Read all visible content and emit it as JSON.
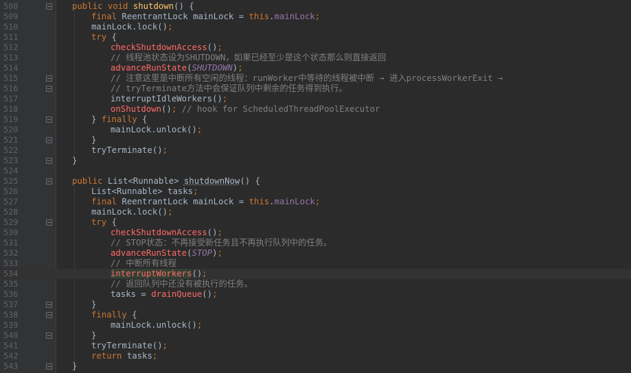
{
  "editor": {
    "lines": [
      {
        "n": "508",
        "indent": 0,
        "fold": true,
        "tokens": [
          [
            "kw",
            "public void "
          ],
          [
            "fn",
            "shutdown"
          ],
          [
            "txt",
            "() {"
          ]
        ]
      },
      {
        "n": "509",
        "indent": 1,
        "tokens": [
          [
            "kw",
            "final "
          ],
          [
            "txt",
            "ReentrantLock mainLock = "
          ],
          [
            "kw",
            "this"
          ],
          [
            "txt",
            "."
          ],
          [
            "fd",
            "mainLock"
          ],
          [
            "kw",
            ";"
          ]
        ]
      },
      {
        "n": "510",
        "indent": 1,
        "tokens": [
          [
            "txt",
            "mainLock.lock()"
          ],
          [
            "kw",
            ";"
          ]
        ]
      },
      {
        "n": "511",
        "indent": 1,
        "tokens": [
          [
            "kw",
            "try "
          ],
          [
            "txt",
            "{"
          ]
        ]
      },
      {
        "n": "512",
        "indent": 2,
        "tokens": [
          [
            "call",
            "checkShutdownAccess"
          ],
          [
            "txt",
            "()"
          ],
          [
            "kw",
            ";"
          ]
        ]
      },
      {
        "n": "513",
        "indent": 2,
        "tokens": [
          [
            "cm",
            "// 线程池状态设为SHUTDOWN，如果已经至少是这个状态那么则直接返回"
          ]
        ]
      },
      {
        "n": "514",
        "indent": 2,
        "tokens": [
          [
            "call",
            "advanceRunState"
          ],
          [
            "txt",
            "("
          ],
          [
            "it",
            "SHUTDOWN"
          ],
          [
            "txt",
            ")"
          ],
          [
            "kw",
            ";"
          ]
        ]
      },
      {
        "n": "515",
        "indent": 2,
        "fold": true,
        "tokens": [
          [
            "cm",
            "// 注意这里是中断所有空闲的线程：runWorker中等待的线程被中断 → 进入processWorkerExit →"
          ]
        ]
      },
      {
        "n": "516",
        "indent": 2,
        "fold": true,
        "tokens": [
          [
            "cm",
            "// tryTerminate方法中会保证队列中剩余的任务得到执行。"
          ]
        ]
      },
      {
        "n": "517",
        "indent": 2,
        "tokens": [
          [
            "txt",
            "interruptIdleWorkers()"
          ],
          [
            "kw",
            ";"
          ]
        ]
      },
      {
        "n": "518",
        "indent": 2,
        "tokens": [
          [
            "call",
            "onShutdown"
          ],
          [
            "txt",
            "()"
          ],
          [
            "kw",
            "; "
          ],
          [
            "cm",
            "// hook for ScheduledThreadPoolExecutor"
          ]
        ]
      },
      {
        "n": "519",
        "indent": 1,
        "fold": true,
        "tokens": [
          [
            "txt",
            "} "
          ],
          [
            "kw",
            "finally "
          ],
          [
            "txt",
            "{"
          ]
        ]
      },
      {
        "n": "520",
        "indent": 2,
        "tokens": [
          [
            "txt",
            "mainLock.unlock()"
          ],
          [
            "kw",
            ";"
          ]
        ]
      },
      {
        "n": "521",
        "indent": 1,
        "fold": true,
        "tokens": [
          [
            "txt",
            "}"
          ]
        ]
      },
      {
        "n": "522",
        "indent": 1,
        "tokens": [
          [
            "txt",
            "tryTerminate()"
          ],
          [
            "kw",
            ";"
          ]
        ]
      },
      {
        "n": "523",
        "indent": 0,
        "fold": true,
        "tokens": [
          [
            "txt",
            "}"
          ]
        ]
      },
      {
        "n": "524",
        "indent": 0,
        "tokens": []
      },
      {
        "n": "525",
        "indent": 0,
        "fold": true,
        "tokens": [
          [
            "kw",
            "public "
          ],
          [
            "txt",
            "List<Runnable> "
          ],
          [
            "dep",
            "shutdownNow"
          ],
          [
            "txt",
            "() {"
          ]
        ]
      },
      {
        "n": "526",
        "indent": 1,
        "tokens": [
          [
            "txt",
            "List<Runnable> tasks"
          ],
          [
            "kw",
            ";"
          ]
        ]
      },
      {
        "n": "527",
        "indent": 1,
        "tokens": [
          [
            "kw",
            "final "
          ],
          [
            "txt",
            "ReentrantLock mainLock = "
          ],
          [
            "kw",
            "this"
          ],
          [
            "txt",
            "."
          ],
          [
            "fd",
            "mainLock"
          ],
          [
            "kw",
            ";"
          ]
        ]
      },
      {
        "n": "528",
        "indent": 1,
        "tokens": [
          [
            "txt",
            "mainLock.lock()"
          ],
          [
            "kw",
            ";"
          ]
        ]
      },
      {
        "n": "529",
        "indent": 1,
        "fold": true,
        "tokens": [
          [
            "kw",
            "try "
          ],
          [
            "txt",
            "{"
          ]
        ]
      },
      {
        "n": "530",
        "indent": 2,
        "tokens": [
          [
            "call",
            "checkShutdownAccess"
          ],
          [
            "txt",
            "()"
          ],
          [
            "kw",
            ";"
          ]
        ]
      },
      {
        "n": "531",
        "indent": 2,
        "tokens": [
          [
            "cm",
            "// STOP状态：不再接受新任务且不再执行队列中的任务。"
          ]
        ]
      },
      {
        "n": "532",
        "indent": 2,
        "tokens": [
          [
            "call",
            "advanceRunState"
          ],
          [
            "txt",
            "("
          ],
          [
            "it",
            "STOP"
          ],
          [
            "txt",
            ")"
          ],
          [
            "kw",
            ";"
          ]
        ]
      },
      {
        "n": "533",
        "indent": 2,
        "tokens": [
          [
            "cm",
            "// 中断所有线程"
          ]
        ]
      },
      {
        "n": "534",
        "indent": 2,
        "current": true,
        "tokens": [
          [
            "call iw",
            "interruptWorkers"
          ],
          [
            "txt",
            "()"
          ],
          [
            "kw",
            ";"
          ]
        ]
      },
      {
        "n": "535",
        "indent": 2,
        "tokens": [
          [
            "cm",
            "// 返回队列中还没有被执行的任务。"
          ]
        ]
      },
      {
        "n": "536",
        "indent": 2,
        "tokens": [
          [
            "txt",
            "tasks = "
          ],
          [
            "call",
            "drainQueue"
          ],
          [
            "txt",
            "()"
          ],
          [
            "kw",
            ";"
          ]
        ]
      },
      {
        "n": "537",
        "indent": 1,
        "fold": true,
        "tokens": [
          [
            "txt",
            "}"
          ]
        ]
      },
      {
        "n": "538",
        "indent": 1,
        "fold": true,
        "tokens": [
          [
            "kw",
            "finally "
          ],
          [
            "txt",
            "{"
          ]
        ]
      },
      {
        "n": "539",
        "indent": 2,
        "tokens": [
          [
            "txt",
            "mainLock.unlock()"
          ],
          [
            "kw",
            ";"
          ]
        ]
      },
      {
        "n": "540",
        "indent": 1,
        "fold": true,
        "tokens": [
          [
            "txt",
            "}"
          ]
        ]
      },
      {
        "n": "541",
        "indent": 1,
        "tokens": [
          [
            "txt",
            "tryTerminate()"
          ],
          [
            "kw",
            ";"
          ]
        ]
      },
      {
        "n": "542",
        "indent": 1,
        "tokens": [
          [
            "kw",
            "return "
          ],
          [
            "txt",
            "tasks"
          ],
          [
            "kw",
            ";"
          ]
        ]
      },
      {
        "n": "543",
        "indent": 0,
        "fold": true,
        "tokens": [
          [
            "txt",
            "}"
          ]
        ]
      }
    ]
  }
}
